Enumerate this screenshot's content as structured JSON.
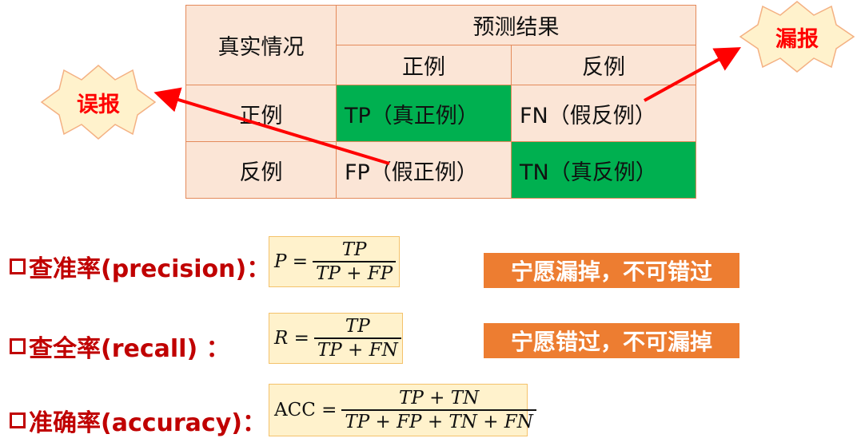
{
  "table": {
    "header_actual": "真实情况",
    "header_predicted": "预测结果",
    "col_positive": "正例",
    "col_negative": "反例",
    "row_positive": "正例",
    "row_negative": "反例",
    "tp": "TP（真正例）",
    "fn": "FN（假反例）",
    "fp": "FP（假正例）",
    "tn": "TN（真反例）"
  },
  "badges": {
    "false_alarm": "误报",
    "missed": "漏报"
  },
  "metrics": [
    {
      "label": "查准率(precision)：",
      "lhs": "P =",
      "numerator": "TP",
      "denominator": "TP + FP",
      "tag": "宁愿漏掉，不可错过"
    },
    {
      "label": "查全率(recall) ：",
      "lhs": "R =",
      "numerator": "TP",
      "denominator": "TP + FN",
      "tag": "宁愿错过，不可漏掉"
    },
    {
      "label": "准确率(accuracy)：",
      "lhs": "ACC =",
      "numerator": "TP + TN",
      "denominator": "TP + FP + TN + FN"
    }
  ],
  "colors": {
    "green_cell": "#00b050",
    "table_bg": "#fbe5d6",
    "label_red": "#c00000",
    "arrow_red": "#ff0000",
    "tag_orange": "#ed7d31",
    "formula_bg": "#fff2cc",
    "badge_fill": "#fff2cc"
  }
}
